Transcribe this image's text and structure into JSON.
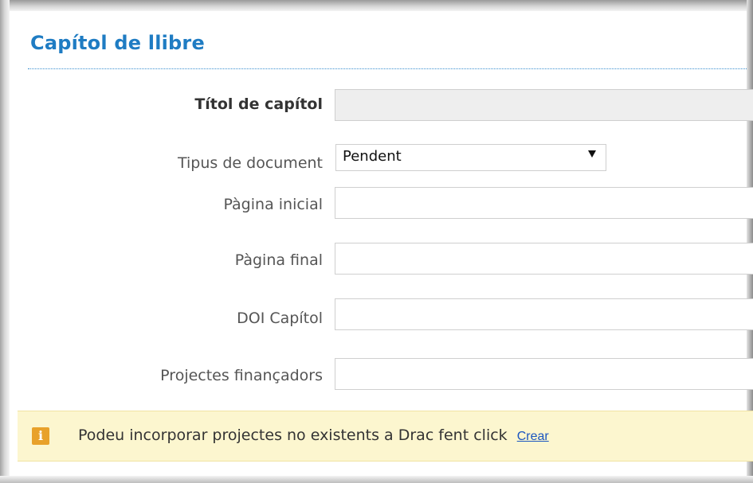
{
  "section": {
    "title": "Capítol de llibre"
  },
  "form": {
    "titol_label": "Títol de capítol",
    "titol_value": "",
    "tipus_label": "Tipus de document",
    "tipus_selected": "Pendent",
    "pagina_inicial_label": "Pàgina inicial",
    "pagina_inicial_value": "",
    "pagina_final_label": "Pàgina final",
    "pagina_final_value": "",
    "doi_label": "DOI Capítol",
    "doi_value": "",
    "projectes_label": "Projectes finançadors",
    "projectes_value": ""
  },
  "notice": {
    "icon": "info-icon",
    "icon_glyph": "i",
    "message": "Podeu incorporar projectes no existents a Drac fent click",
    "link_label": "Crear"
  },
  "colors": {
    "title": "#1f7cc3",
    "notice_bg": "#fcf6cf",
    "notice_icon": "#e8a12a",
    "link": "#1a55c0"
  }
}
